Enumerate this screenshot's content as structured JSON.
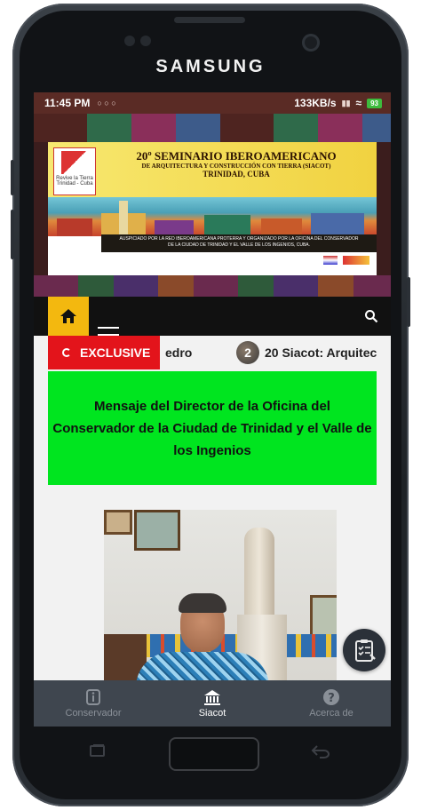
{
  "device": {
    "brand": "SAMSUNG"
  },
  "statusbar": {
    "time": "11:45 PM",
    "speed": "133KB/s",
    "battery": "93"
  },
  "banner": {
    "title_line1": "20º SEMINARIO IBEROAMERICANO",
    "title_line2": "DE ARQUITECTURA Y CONSTRUCCIÓN CON TIERRA (SIACOT)",
    "title_line3": "TRINIDAD, CUBA",
    "logo_text": "Revive la Tierra Trinidad - Cuba",
    "sponsor_line1": "AUSPICIADO POR LA RED IBEROAMERICANA PROTERRA Y ORGANIZADO POR LA OFICINA DEL CONSERVADOR",
    "sponsor_line2": "DE LA CIUDAD DE TRINIDAD Y EL VALLE DE LOS INGENIOS, CUBA."
  },
  "ticker": {
    "badge": "EXCLUSIVE",
    "item1": "edro",
    "thumb_text": "2",
    "item2": "20 Siacot: Arquitec"
  },
  "article": {
    "heading": "Mensaje del Director de la Oficina del Conservador de la Ciudad de Trinidad y el Valle de los Ingenios"
  },
  "bottom_nav": {
    "items": [
      {
        "label": "Conservador",
        "icon": "info-icon",
        "active": false
      },
      {
        "label": "Siacot",
        "icon": "building-icon",
        "active": true
      },
      {
        "label": "Acerca de",
        "icon": "help-icon",
        "active": false
      }
    ]
  },
  "colors": {
    "statusbar": "#5a2b25",
    "home_accent": "#f3b80f",
    "exclusive": "#e3141b",
    "article_box": "#00e51f",
    "bottom_nav": "#3f464f"
  }
}
